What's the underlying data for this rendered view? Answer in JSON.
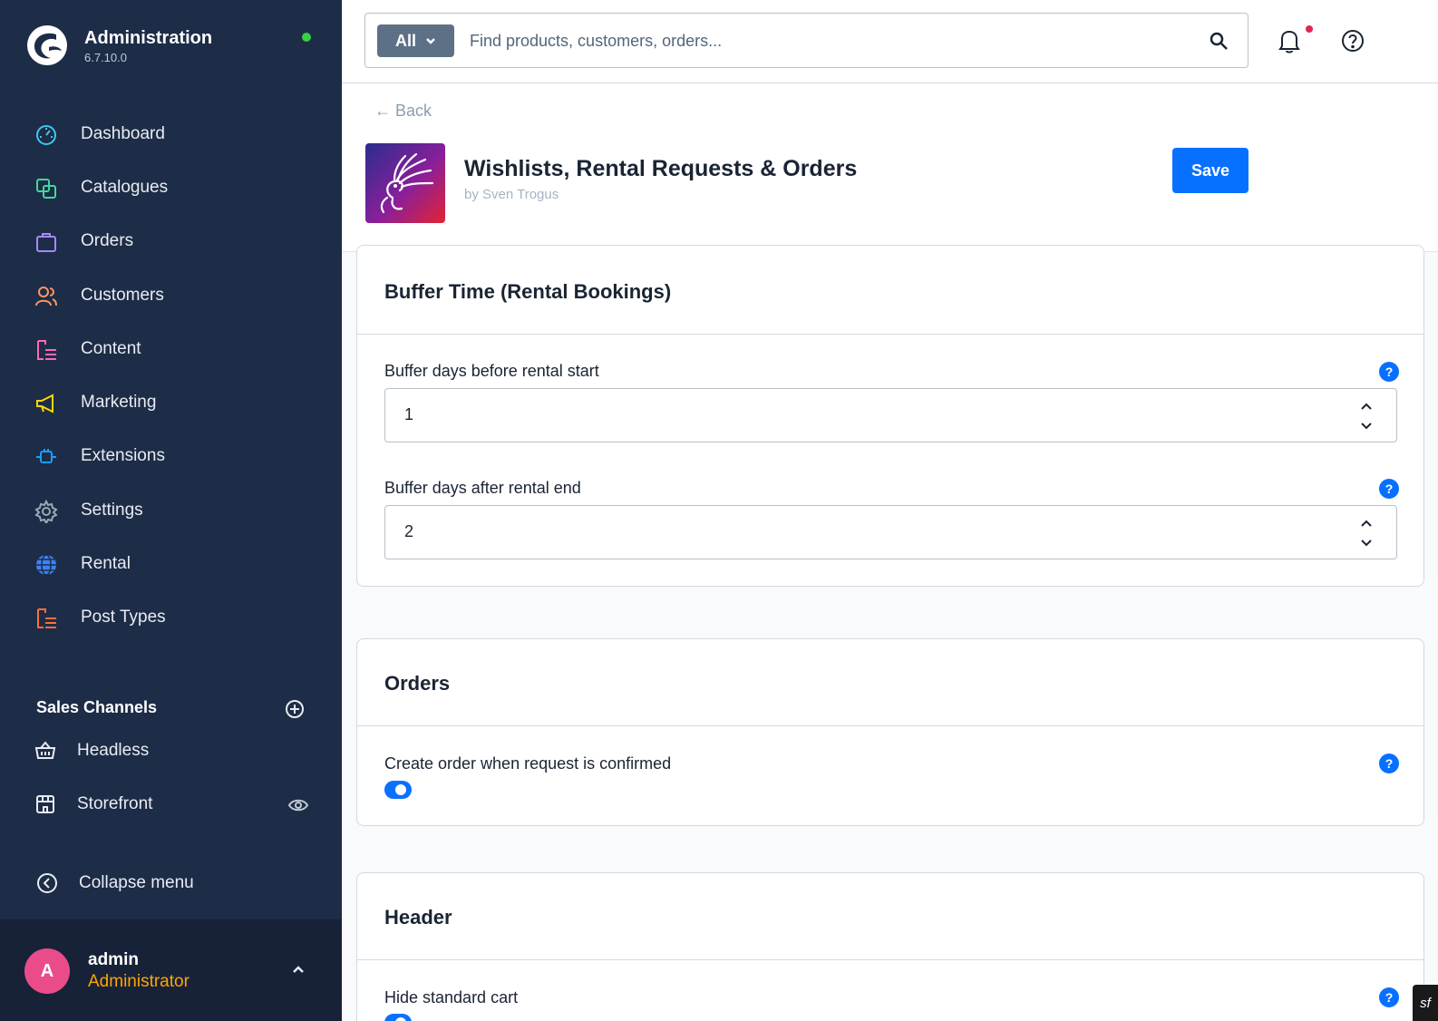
{
  "brand": {
    "title": "Administration",
    "version": "6.7.10.0"
  },
  "nav": [
    {
      "label": "Dashboard",
      "icon": "dashboard-icon",
      "color": "#3ec6f0"
    },
    {
      "label": "Catalogues",
      "icon": "catalogues-icon",
      "color": "#40d99b"
    },
    {
      "label": "Orders",
      "icon": "orders-icon",
      "color": "#a888ff"
    },
    {
      "label": "Customers",
      "icon": "customers-icon",
      "color": "#ff9566"
    },
    {
      "label": "Content",
      "icon": "content-icon",
      "color": "#ff68b4"
    },
    {
      "label": "Marketing",
      "icon": "marketing-icon",
      "color": "#ffd700"
    },
    {
      "label": "Extensions",
      "icon": "extensions-icon",
      "color": "#189eff"
    },
    {
      "label": "Settings",
      "icon": "settings-icon",
      "color": "#9aa8b5"
    },
    {
      "label": "Rental",
      "icon": "globe-icon",
      "color": "#3b82f6"
    },
    {
      "label": "Post Types",
      "icon": "content-icon",
      "color": "#ff6e3b"
    }
  ],
  "sales_channels": {
    "title": "Sales Channels",
    "items": [
      {
        "label": "Headless",
        "icon": "basket-icon"
      },
      {
        "label": "Storefront",
        "icon": "storefront-icon"
      }
    ]
  },
  "collapse_label": "Collapse menu",
  "user": {
    "initial": "A",
    "name": "admin",
    "role": "Administrator"
  },
  "search": {
    "type_label": "All",
    "placeholder": "Find products, customers, orders..."
  },
  "header": {
    "back_label": "← Back",
    "app_title": "Wishlists, Rental Requests & Orders",
    "app_author": "by Sven Trogus",
    "save_label": "Save"
  },
  "cards": {
    "buffer": {
      "title": "Buffer Time (Rental Bookings)",
      "before_label": "Buffer days before rental start",
      "before_value": "1",
      "after_label": "Buffer days after rental end",
      "after_value": "2"
    },
    "orders": {
      "title": "Orders",
      "create_label": "Create order when request is confirmed",
      "create_enabled": true
    },
    "header": {
      "title": "Header",
      "hide_cart_label": "Hide standard cart"
    }
  },
  "help_glyph": "?",
  "accent_color": "#0870ff"
}
